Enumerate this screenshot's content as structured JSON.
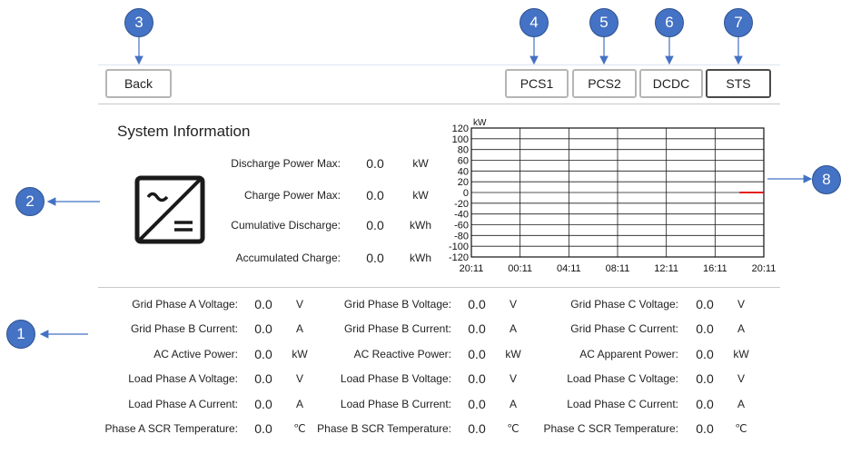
{
  "callouts": [
    "1",
    "2",
    "3",
    "4",
    "5",
    "6",
    "7",
    "8"
  ],
  "header": {
    "back_label": "Back",
    "tabs": [
      {
        "label": "PCS1",
        "active": false
      },
      {
        "label": "PCS2",
        "active": false
      },
      {
        "label": "DCDC",
        "active": false
      },
      {
        "label": "STS",
        "active": true
      }
    ]
  },
  "system": {
    "title": "System Information",
    "icon": "inverter-icon",
    "rows": [
      {
        "label": "Discharge Power Max:",
        "value": "0.0",
        "unit": "kW"
      },
      {
        "label": "Charge Power Max:",
        "value": "0.0",
        "unit": "kW"
      },
      {
        "label": "Cumulative Discharge:",
        "value": "0.0",
        "unit": "kWh"
      },
      {
        "label": "Accumulated Charge:",
        "value": "0.0",
        "unit": "kWh"
      }
    ]
  },
  "chart_data": {
    "type": "line",
    "title": "",
    "ylabel": "kW",
    "xlabel": "",
    "ylim": [
      -120,
      120
    ],
    "yticks": [
      120,
      100,
      80,
      60,
      40,
      20,
      0,
      -20,
      -40,
      -60,
      -80,
      -100,
      -120
    ],
    "xticks": [
      "20:11",
      "00:11",
      "04:11",
      "08:11",
      "12:11",
      "16:11",
      "20:11"
    ],
    "grid": true,
    "series": [
      {
        "color": "#e00000",
        "x": [
          "18:11",
          "20:11"
        ],
        "values": [
          0,
          0
        ]
      }
    ]
  },
  "grid_data": {
    "columns": [
      [
        {
          "label": "Grid Phase A Voltage:",
          "value": "0.0",
          "unit": "V"
        },
        {
          "label": "Grid Phase B Current:",
          "value": "0.0",
          "unit": "A"
        },
        {
          "label": "AC Active Power:",
          "value": "0.0",
          "unit": "kW"
        },
        {
          "label": "Load Phase A Voltage:",
          "value": "0.0",
          "unit": "V"
        },
        {
          "label": "Load Phase A Current:",
          "value": "0.0",
          "unit": "A"
        },
        {
          "label": "Phase A SCR Temperature:",
          "value": "0.0",
          "unit": "℃"
        }
      ],
      [
        {
          "label": "Grid Phase B Voltage:",
          "value": "0.0",
          "unit": "V"
        },
        {
          "label": "Grid Phase B Current:",
          "value": "0.0",
          "unit": "A"
        },
        {
          "label": "AC Reactive Power:",
          "value": "0.0",
          "unit": "kW"
        },
        {
          "label": "Load Phase B Voltage:",
          "value": "0.0",
          "unit": "V"
        },
        {
          "label": "Load Phase B Current:",
          "value": "0.0",
          "unit": "A"
        },
        {
          "label": "Phase B SCR Temperature:",
          "value": "0.0",
          "unit": "℃"
        }
      ],
      [
        {
          "label": "Grid Phase C Voltage:",
          "value": "0.0",
          "unit": "V"
        },
        {
          "label": "Grid Phase C Current:",
          "value": "0.0",
          "unit": "A"
        },
        {
          "label": "AC Apparent Power:",
          "value": "0.0",
          "unit": "kW"
        },
        {
          "label": "Load Phase C Voltage:",
          "value": "0.0",
          "unit": "V"
        },
        {
          "label": "Load Phase C Current:",
          "value": "0.0",
          "unit": "A"
        },
        {
          "label": "Phase C SCR Temperature:",
          "value": "0.0",
          "unit": "℃"
        }
      ]
    ]
  },
  "colors": {
    "callout": "#4472C4",
    "arrow": "#4472C4",
    "active_tab_border": "#4a4a4a",
    "tab_border": "#b5b5b5",
    "chart_line": "#e00000"
  }
}
